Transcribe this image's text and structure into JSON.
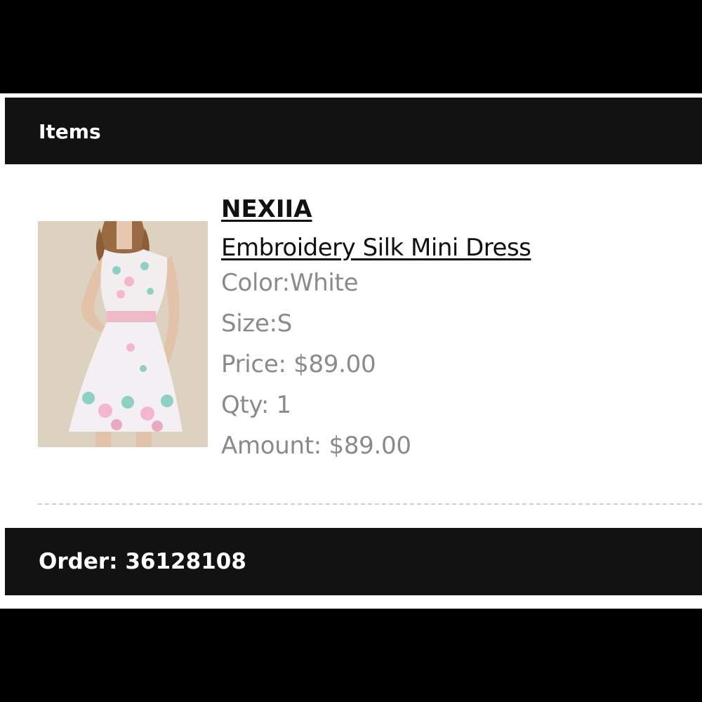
{
  "header": {
    "title": "Items"
  },
  "item": {
    "image_alt": "Embroidery silk mini dress product photo",
    "brand": "NEXIIA",
    "name": "Embroidery Silk Mini Dress",
    "color_label": "Color:",
    "color_value": "White",
    "size_label": "Size:",
    "size_value": "S",
    "price_label": "Price: ",
    "price_value": "$89.00",
    "qty_label": "Qty: ",
    "qty_value": "1",
    "amount_label": "Amount: ",
    "amount_value": "$89.00"
  },
  "footer": {
    "order_label": "Order: ",
    "order_number": "36128108"
  },
  "colors": {
    "bar_background": "#121212",
    "secondary_text": "#8a8a8a",
    "primary_text": "#111111"
  }
}
